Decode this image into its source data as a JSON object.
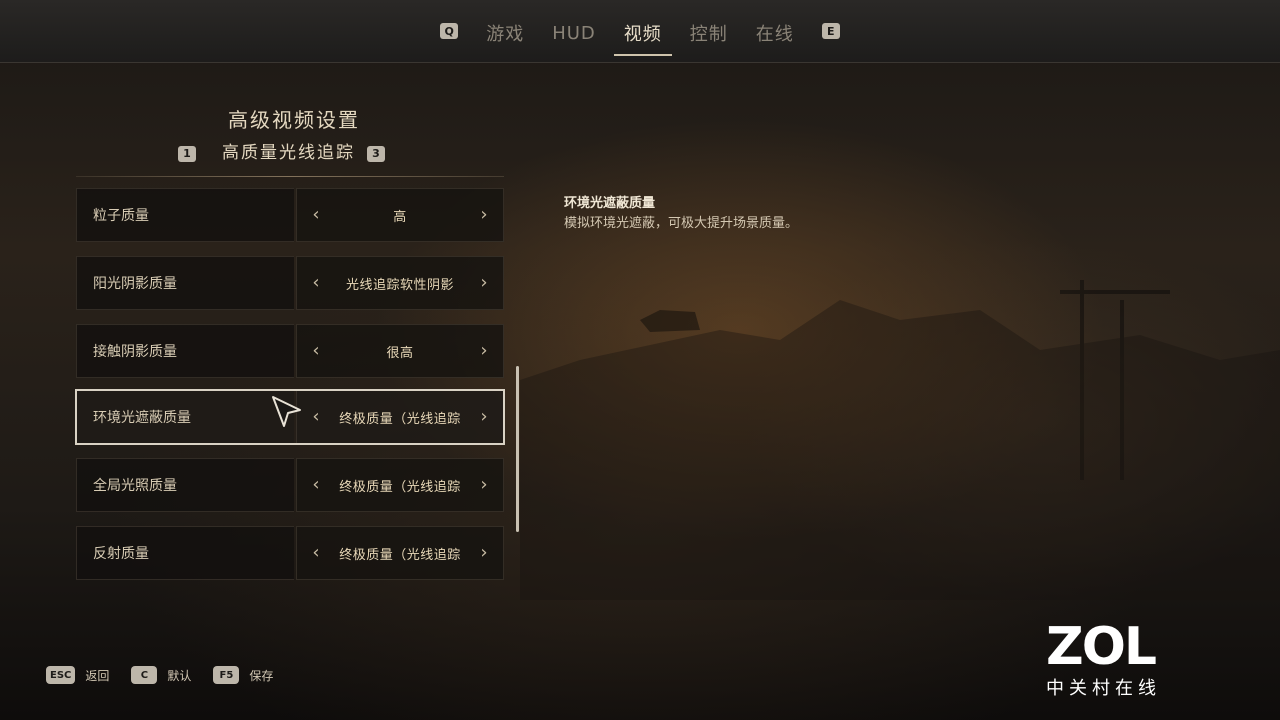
{
  "tabs": {
    "prev_key": "Q",
    "next_key": "E",
    "items": [
      {
        "label": "游戏",
        "active": false
      },
      {
        "label": "HUD",
        "active": false
      },
      {
        "label": "视频",
        "active": true
      },
      {
        "label": "控制",
        "active": false
      },
      {
        "label": "在线",
        "active": false
      }
    ]
  },
  "section": {
    "title": "高级视频设置",
    "subtitle": "高质量光线追踪",
    "prev_key": "1",
    "next_key": "3"
  },
  "settings": [
    {
      "label": "粒子质量",
      "value": "高",
      "selected": false
    },
    {
      "label": "阳光阴影质量",
      "value": "光线追踪软性阴影",
      "selected": false
    },
    {
      "label": "接触阴影质量",
      "value": "很高",
      "selected": false
    },
    {
      "label": "环境光遮蔽质量",
      "value": "终极质量（光线追踪",
      "selected": true
    },
    {
      "label": "全局光照质量",
      "value": "终极质量（光线追踪",
      "selected": false
    },
    {
      "label": "反射质量",
      "value": "终极质量（光线追踪",
      "selected": false
    }
  ],
  "description": {
    "title": "环境光遮蔽质量",
    "text": "模拟环境光遮蔽，可极大提升场景质量。"
  },
  "hints": [
    {
      "key": "ESC",
      "label": "返回"
    },
    {
      "key": "C",
      "label": "默认"
    },
    {
      "key": "F5",
      "label": "保存"
    }
  ],
  "watermark": {
    "brand": "ZOL",
    "sub": "中关村在线"
  },
  "icons": {
    "prev": "chevron-left-icon",
    "next": "chevron-right-icon",
    "cursor": "mouse-pointer-icon"
  }
}
